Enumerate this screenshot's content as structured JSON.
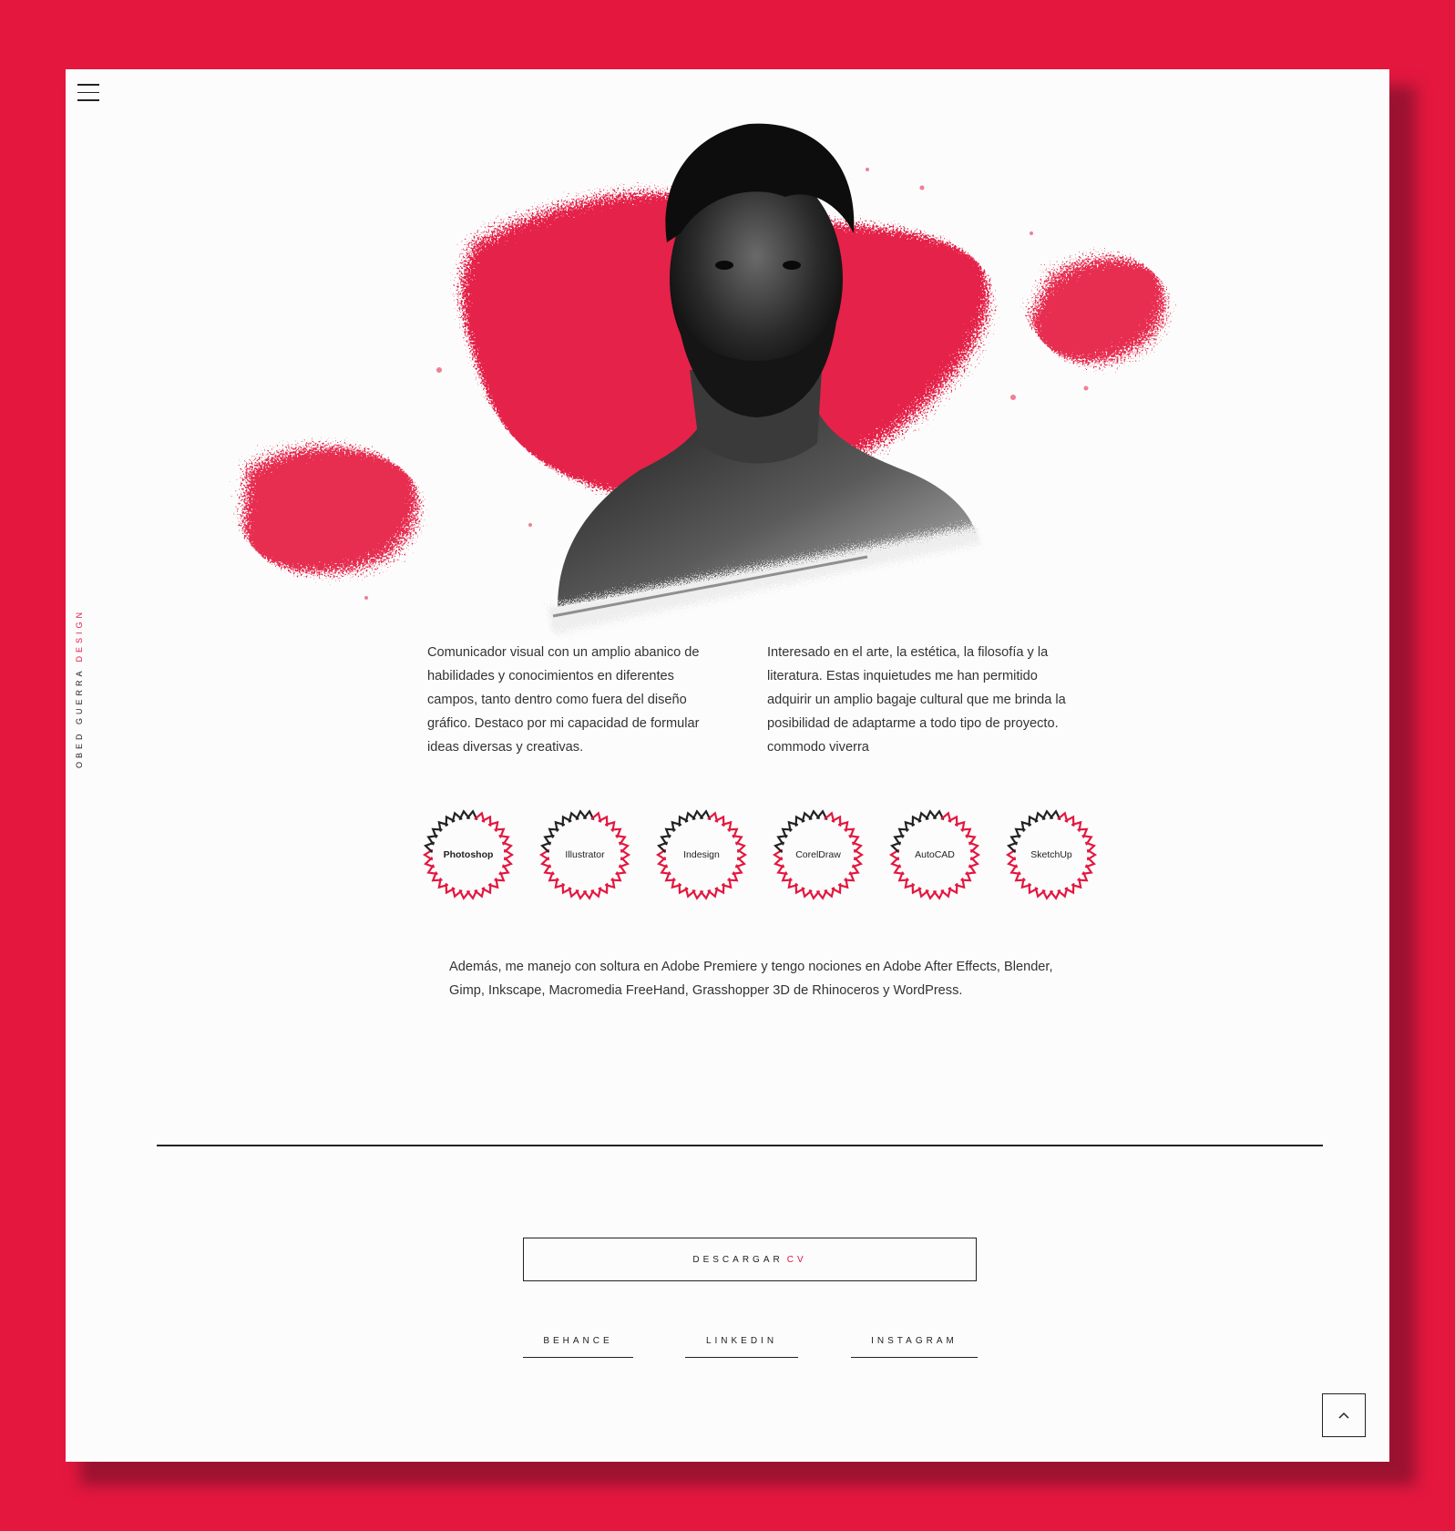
{
  "colors": {
    "accent": "#e4173f",
    "text": "#222222",
    "card": "#fcfcfc"
  },
  "brand": {
    "name": "OBED GUERRA",
    "accent_word": "DESIGN"
  },
  "bio": {
    "left": "Comunicador visual con un amplio abanico de habilidades y conocimientos en diferentes campos, tanto dentro como fuera del diseño gráfico. Destaco por mi capacidad de formular ideas diversas y creativas.",
    "right": "Interesado en el arte, la estética, la filosofía y la literatura. Estas inquietudes me han permitido adquirir un amplio bagaje cultural que me brinda la posibilidad de adaptarme a todo tipo de proyecto. commodo viverra"
  },
  "skills": [
    {
      "label": "Photoshop",
      "icon": "laurel-wreath-icon"
    },
    {
      "label": "Illustrator",
      "icon": "laurel-wreath-icon"
    },
    {
      "label": "Indesign",
      "icon": "laurel-wreath-icon"
    },
    {
      "label": "CorelDraw",
      "icon": "laurel-wreath-icon"
    },
    {
      "label": "AutoCAD",
      "icon": "laurel-wreath-icon"
    },
    {
      "label": "SketchUp",
      "icon": "laurel-wreath-icon"
    }
  ],
  "extra_text": "Además, me manejo con soltura en Adobe Premiere y tengo nociones en Adobe After Effects, Blender, Gimp, Inkscape, Macromedia FreeHand, Grasshopper 3D de Rhinoceros y WordPress.",
  "cv_button": {
    "label": "DESCARGAR",
    "accent": "CV"
  },
  "social": {
    "behance": "BEHANCE",
    "linkedin": "LINKEDIN",
    "instagram": "INSTAGRAM"
  },
  "icons": {
    "menu": "hamburger-menu-icon",
    "back_to_top": "chevron-up-icon"
  }
}
